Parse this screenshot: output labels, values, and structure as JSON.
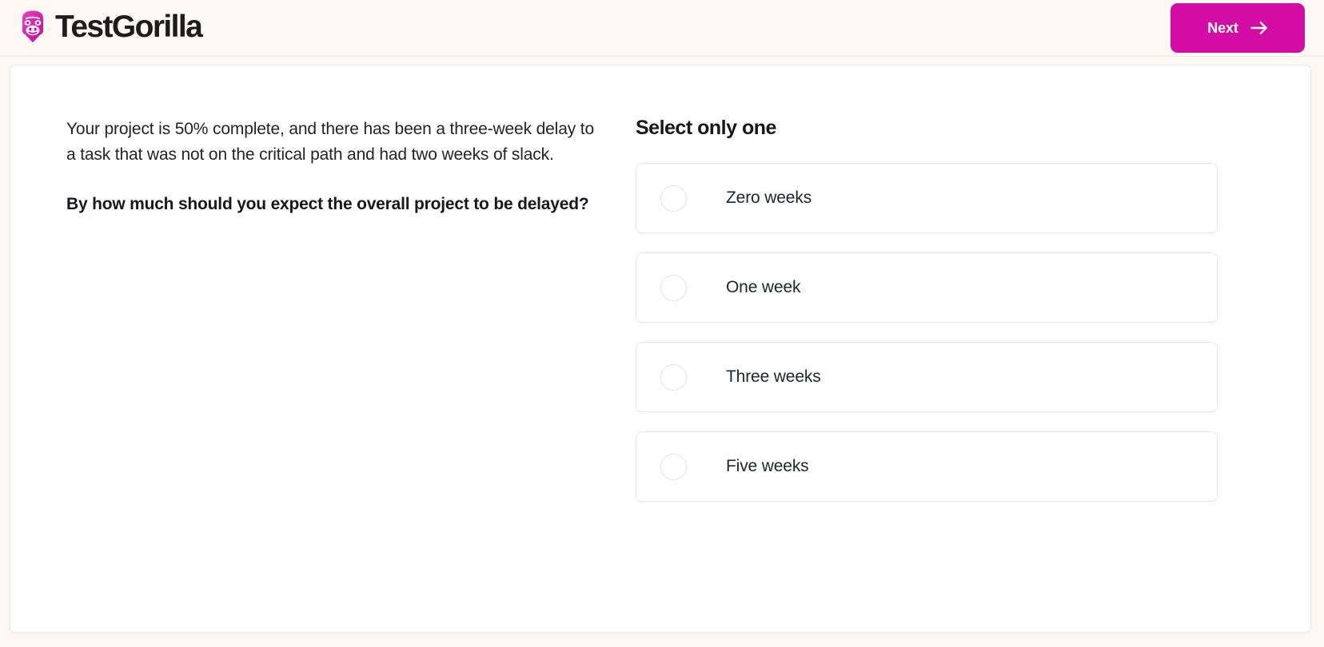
{
  "header": {
    "brand_name": "TestGorilla",
    "brand_icon": "gorilla-logo-icon",
    "brand_color": "#d30ca5",
    "next_label": "Next",
    "next_icon": "arrow-right-icon",
    "next_color": "#d30ca5"
  },
  "question": {
    "stem": "Your project is 50% complete, and there has been a three-week delay to a task that was not on the critical path and had two weeks of slack.",
    "prompt": "By how much should you expect the overall project to be delayed?"
  },
  "answers": {
    "heading": "Select only one",
    "options": [
      {
        "label": "Zero weeks",
        "selected": false
      },
      {
        "label": "One week",
        "selected": false
      },
      {
        "label": "Three weeks",
        "selected": false
      },
      {
        "label": "Five weeks",
        "selected": false
      }
    ]
  },
  "colors": {
    "page_background": "#fdf8f3",
    "card_background": "#ffffff",
    "accent": "#d30ca5",
    "text": "#21252c",
    "border": "#e9e7e7"
  }
}
